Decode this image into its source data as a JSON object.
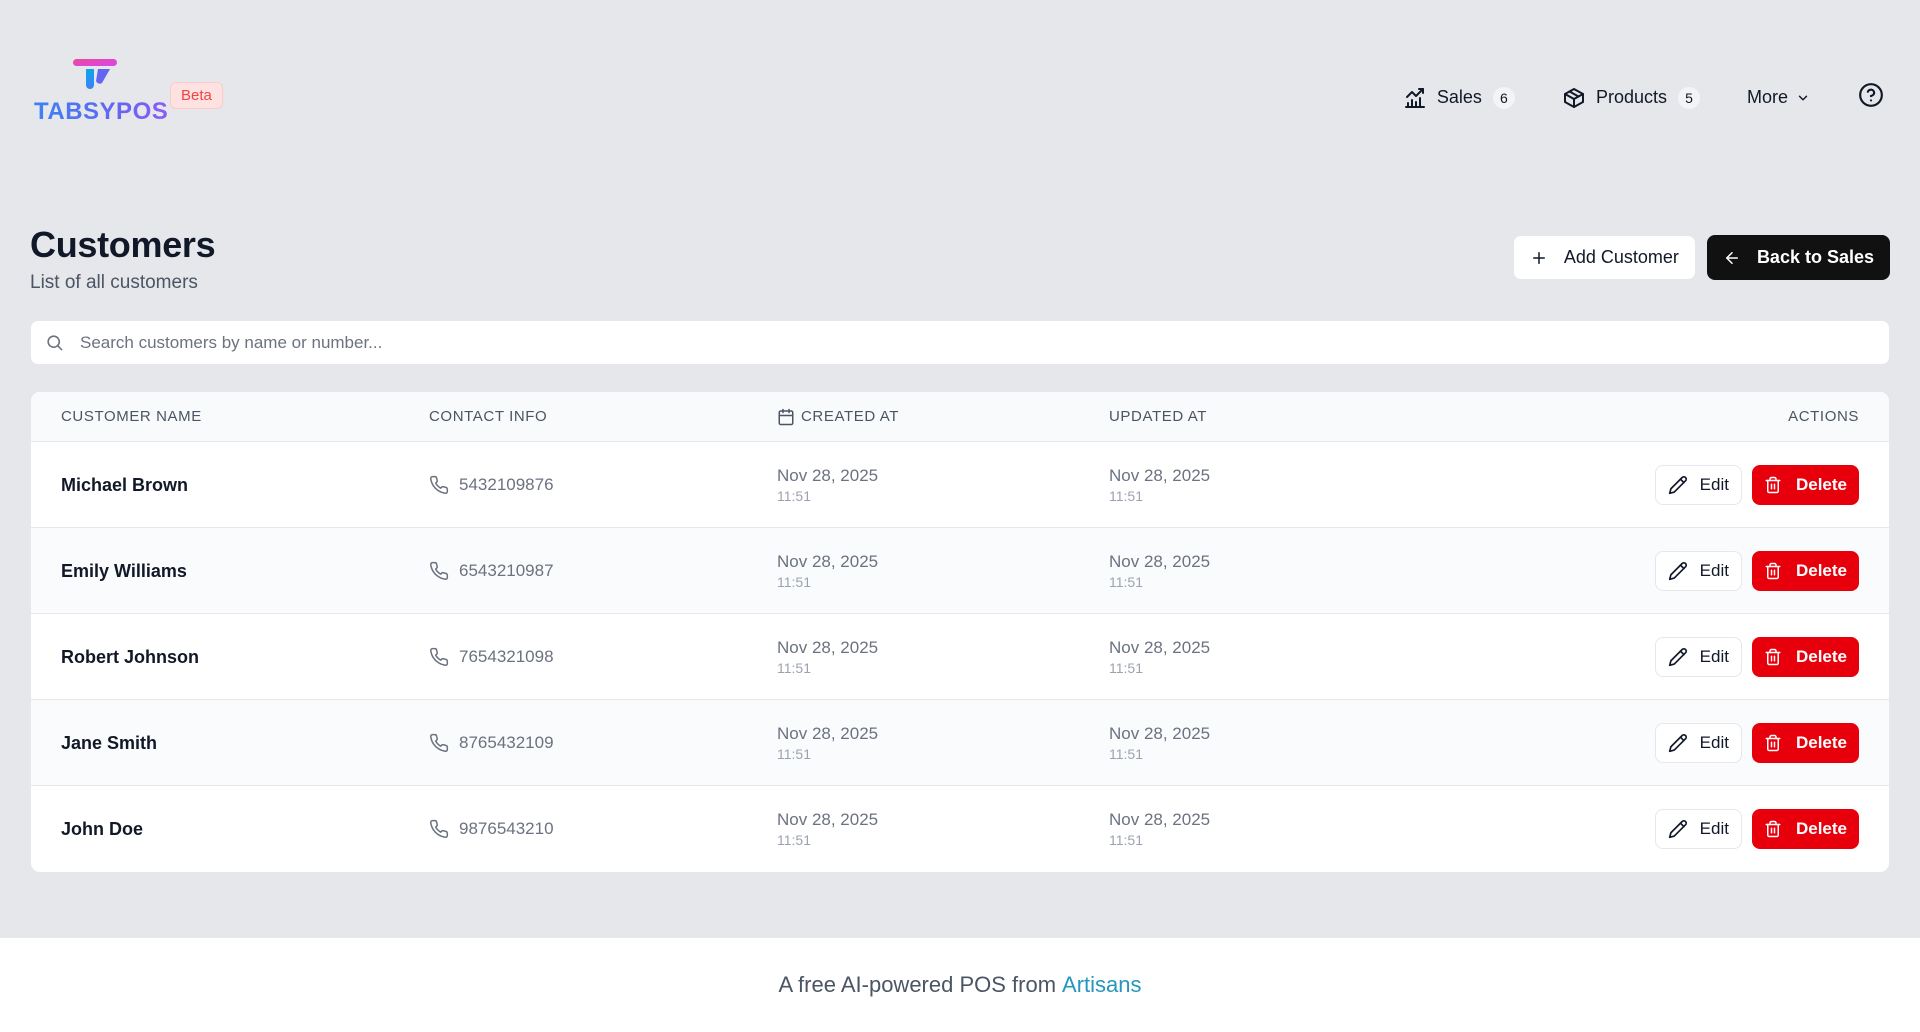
{
  "brand": {
    "logo_text": "TABSYPOS",
    "badge": "Beta"
  },
  "nav": {
    "sales": {
      "label": "Sales",
      "count": "6"
    },
    "products": {
      "label": "Products",
      "count": "5"
    },
    "more": {
      "label": "More"
    }
  },
  "page": {
    "title": "Customers",
    "subtitle": "List of all customers",
    "add_button": "Add Customer",
    "back_button": "Back to Sales"
  },
  "search": {
    "placeholder": "Search customers by name or number..."
  },
  "table": {
    "headers": {
      "name": "CUSTOMER NAME",
      "contact": "CONTACT INFO",
      "created": "CREATED AT",
      "updated": "UPDATED AT",
      "actions": "ACTIONS"
    },
    "edit_label": "Edit",
    "delete_label": "Delete",
    "rows": [
      {
        "name": "Michael Brown",
        "phone": "5432109876",
        "created_date": "Nov 28, 2025",
        "created_time": "11:51",
        "updated_date": "Nov 28, 2025",
        "updated_time": "11:51"
      },
      {
        "name": "Emily Williams",
        "phone": "6543210987",
        "created_date": "Nov 28, 2025",
        "created_time": "11:51",
        "updated_date": "Nov 28, 2025",
        "updated_time": "11:51"
      },
      {
        "name": "Robert Johnson",
        "phone": "7654321098",
        "created_date": "Nov 28, 2025",
        "created_time": "11:51",
        "updated_date": "Nov 28, 2025",
        "updated_time": "11:51"
      },
      {
        "name": "Jane Smith",
        "phone": "8765432109",
        "created_date": "Nov 28, 2025",
        "created_time": "11:51",
        "updated_date": "Nov 28, 2025",
        "updated_time": "11:51"
      },
      {
        "name": "John Doe",
        "phone": "9876543210",
        "created_date": "Nov 28, 2025",
        "created_time": "11:51",
        "updated_date": "Nov 28, 2025",
        "updated_time": "11:51"
      }
    ]
  },
  "footer": {
    "text": "A free AI-powered POS from",
    "link": "Artisans"
  },
  "colors": {
    "danger": "#e7000b",
    "dark": "#111111",
    "link": "#2596be",
    "logo_pink": "#ec4899",
    "logo_blue": "#3b82f6"
  }
}
